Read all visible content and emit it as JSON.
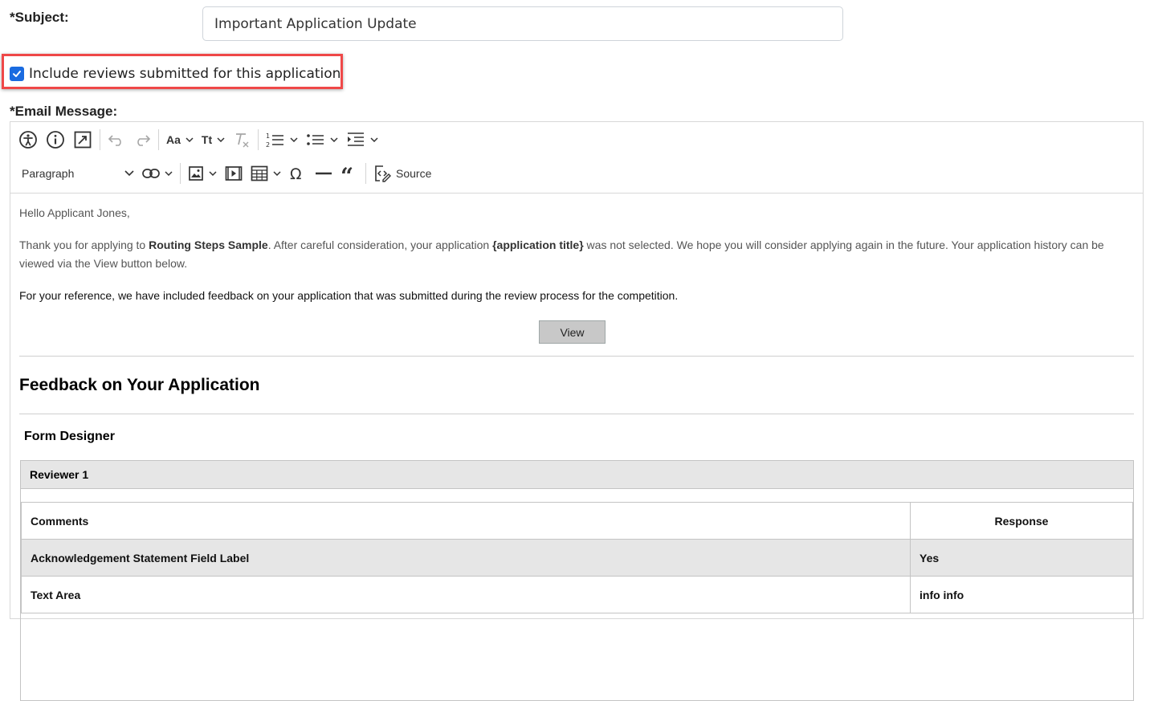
{
  "subject": {
    "label": "*Subject:",
    "value": "Important Application Update"
  },
  "include_reviews": {
    "label": "Include reviews submitted for this application",
    "checked": true
  },
  "email_message": {
    "label": "*Email Message:"
  },
  "toolbar": {
    "font_size_label": "Aa",
    "text_transform_label": "Tt",
    "paragraph_label": "Paragraph",
    "source_label": "Source",
    "icons": [
      "accessibility-icon",
      "info-icon",
      "fullscreen-icon",
      "undo-icon",
      "redo-icon",
      "font-size-icon",
      "text-transform-icon",
      "remove-format-icon",
      "numbered-list-icon",
      "bulleted-list-icon",
      "indent-icon",
      "link-icon",
      "image-icon",
      "media-icon",
      "table-icon",
      "special-characters-icon",
      "horizontal-line-icon",
      "block-quote-icon",
      "source-icon"
    ]
  },
  "body": {
    "greeting": "Hello Applicant Jones,",
    "p1_a": "Thank you for applying to ",
    "p1_b": "Routing Steps Sample",
    "p1_c": ". After careful consideration, your application ",
    "p1_d": "{application title}",
    "p1_e": " was not selected. We hope you will consider applying again in the future. Your application history can be viewed via the View button below.",
    "p2": "For your reference, we have included feedback on your application that was submitted during the review process for the competition.",
    "view_button": "View",
    "feedback_title": "Feedback on Your Application",
    "form_designer": "Form Designer",
    "reviewer": "Reviewer 1",
    "table": {
      "headers": [
        "Comments",
        "Response"
      ],
      "rows": [
        [
          "Acknowledgement Statement Field Label",
          "Yes"
        ],
        [
          "Text Area",
          "info info"
        ]
      ]
    }
  },
  "colors": {
    "checkbox": "#1a6be0",
    "highlight": "#ef4848",
    "view_button_bg": "#c8c8c8"
  }
}
